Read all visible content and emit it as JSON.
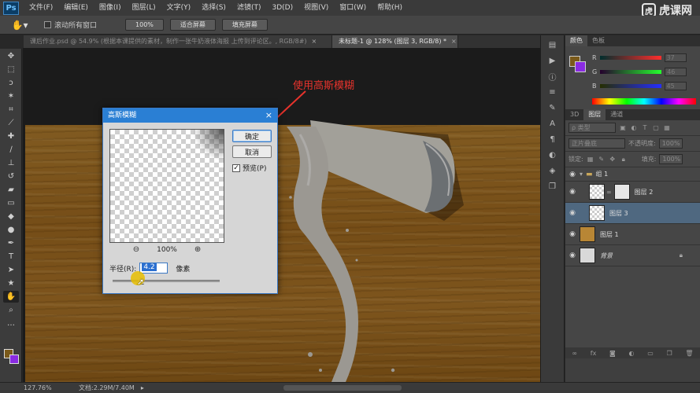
{
  "menu": {
    "logo": "Ps",
    "items": [
      "文件(F)",
      "编辑(E)",
      "图像(I)",
      "图层(L)",
      "文字(Y)",
      "选择(S)",
      "滤镜(T)",
      "3D(D)",
      "视图(V)",
      "窗口(W)",
      "帮助(H)"
    ]
  },
  "watermark": {
    "text": "虎课网",
    "badge": "虎"
  },
  "options": {
    "scroll_all": "滚动所有窗口",
    "btn_100": "100%",
    "btn_fit": "适合屏幕",
    "btn_fill": "填充屏幕"
  },
  "tabs": [
    {
      "label": "课后作业.psd @ 54.9% (根据本课提供的素材，制作一张牛奶液体海报 上传到评论区。, RGB/8#)"
    },
    {
      "label": "未标题-1 @ 128% (图层 3, RGB/8) *"
    }
  ],
  "tab_close": "×",
  "annotation": "使用高斯模糊",
  "dialog": {
    "title": "高斯模糊",
    "close": "×",
    "ok": "确定",
    "cancel": "取消",
    "preview_label": "预览(P)",
    "preview_check": "✓",
    "zoom_level": "100%",
    "radius_label": "半径(R):",
    "radius_value": "4.2",
    "unit": "像素"
  },
  "color_panel": {
    "tabs": [
      "颜色",
      "色板"
    ],
    "r": "37",
    "g": "46",
    "b": "45"
  },
  "layers_panel": {
    "tabs": [
      "3D",
      "图层",
      "通道"
    ],
    "kind_filter": "ρ 类型",
    "blend_mode": "正片叠底",
    "opacity_label": "不透明度:",
    "opacity": "100%",
    "lock_label": "锁定:",
    "fill_label": "填充:",
    "fill": "100%",
    "layers": [
      {
        "name": "组 1",
        "type": "group"
      },
      {
        "name": "图层 2",
        "type": "layer"
      },
      {
        "name": "图层 3",
        "type": "layer",
        "selected": true
      },
      {
        "name": "图层 1",
        "type": "layer"
      },
      {
        "name": "背景",
        "type": "background"
      }
    ]
  },
  "status": {
    "zoom": "127.76%",
    "doc": "文档:2.29M/7.40M"
  }
}
